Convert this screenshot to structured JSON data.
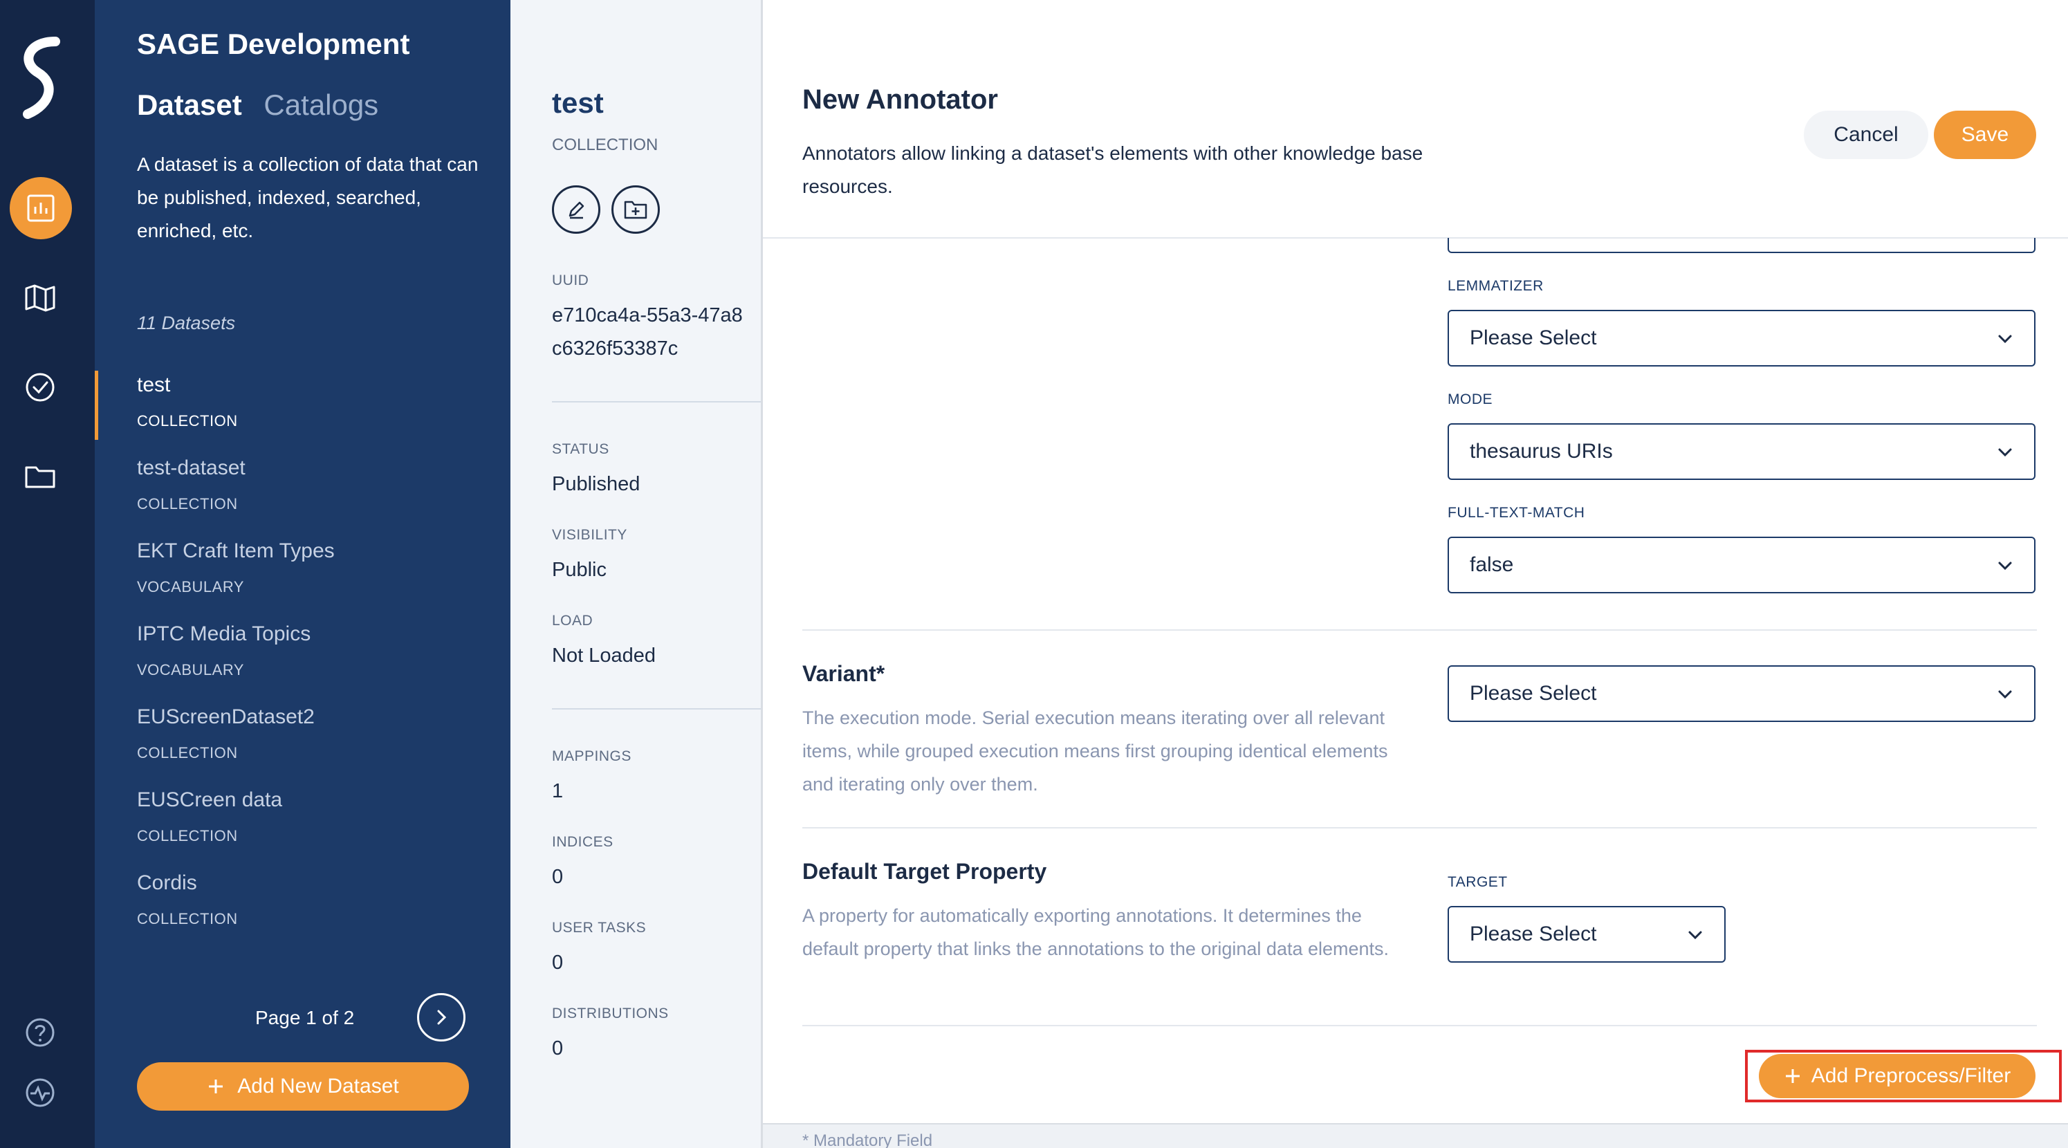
{
  "rail": {
    "icons": [
      "logo-icon",
      "analytics-icon",
      "map-icon",
      "check-circle-icon",
      "folder-icon",
      "help-icon",
      "activity-icon"
    ]
  },
  "datasets_panel": {
    "app_title": "SAGE Development",
    "tab_active": "Dataset",
    "tab_inactive": "Catalogs",
    "description": "A dataset is a collection of data that can be published, indexed, searched, enriched, etc.",
    "count": "11 Datasets",
    "items": [
      {
        "name": "test",
        "type": "COLLECTION"
      },
      {
        "name": "test-dataset",
        "type": "COLLECTION"
      },
      {
        "name": "EKT Craft Item Types",
        "type": "VOCABULARY"
      },
      {
        "name": "IPTC Media Topics",
        "type": "VOCABULARY"
      },
      {
        "name": "EUScreenDataset2",
        "type": "COLLECTION"
      },
      {
        "name": "EUSCreen data",
        "type": "COLLECTION"
      },
      {
        "name": "Cordis",
        "type": "COLLECTION"
      }
    ],
    "pager": "Page 1 of 2",
    "add_button": "Add New Dataset"
  },
  "details": {
    "title": "test",
    "subtitle": "COLLECTION",
    "uuid_label": "UUID",
    "uuid_line1": "e710ca4a-55a3-47a8",
    "uuid_line2": "c6326f53387c",
    "status_label": "STATUS",
    "status_value": "Published",
    "visibility_label": "VISIBILITY",
    "visibility_value": "Public",
    "load_label": "LOAD",
    "load_value": "Not Loaded",
    "mappings_label": "MAPPINGS",
    "mappings_value": "1",
    "indices_label": "INDICES",
    "indices_value": "0",
    "user_tasks_label": "USER TASKS",
    "user_tasks_value": "0",
    "distributions_label": "DISTRIBUTIONS",
    "distributions_value": "0"
  },
  "modal": {
    "title": "New Annotator",
    "description": "Annotators allow linking a dataset's elements with other knowledge base resources.",
    "cancel_label": "Cancel",
    "save_label": "Save",
    "lemmatizer_label": "LEMMATIZER",
    "lemmatizer_value": "Please Select",
    "mode_label": "MODE",
    "mode_value": "thesaurus URIs",
    "full_text_label": "FULL-TEXT-MATCH",
    "full_text_value": "false",
    "variant_title": "Variant*",
    "variant_desc": "The execution mode. Serial execution means iterating over all relevant items, while grouped execution means first grouping identical elements and iterating only over them.",
    "variant_value": "Please Select",
    "target_title": "Default Target Property",
    "target_desc": "A property for automatically exporting annotations. It determines the default property that links the annotations to the original data elements.",
    "target_label": "TARGET",
    "target_value": "Please Select",
    "add_preprocess_label": "Add Preprocess/Filter",
    "footer_note": "* Mandatory Field"
  },
  "colors": {
    "rail_bg": "#142647",
    "panel_bg": "#1c3a68",
    "accent": "#f29a38",
    "highlight": "#e02a2a"
  }
}
